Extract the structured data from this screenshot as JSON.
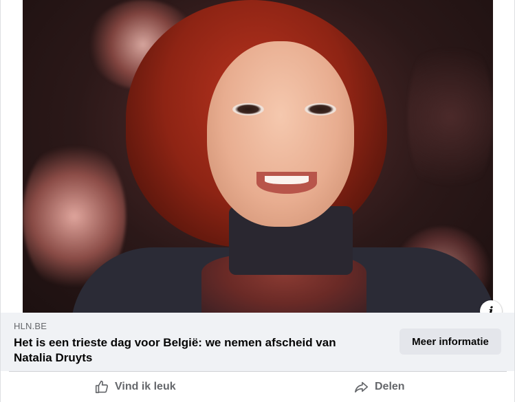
{
  "post": {
    "link": {
      "domain": "HLN.BE",
      "headline": "Het is een trieste dag voor België: we nemen afscheid van Natalia Druyts",
      "cta_label": "Meer informatie",
      "info_label": "i"
    },
    "actions": [
      {
        "label": "Vind ik leuk",
        "icon": "thumbs-up-icon"
      },
      {
        "label": "Delen",
        "icon": "share-icon"
      }
    ]
  },
  "colors": {
    "link_bar_bg": "#f0f2f5",
    "cta_bg": "#e4e6eb",
    "secondary_text": "#65676b",
    "primary_text": "#050505"
  }
}
